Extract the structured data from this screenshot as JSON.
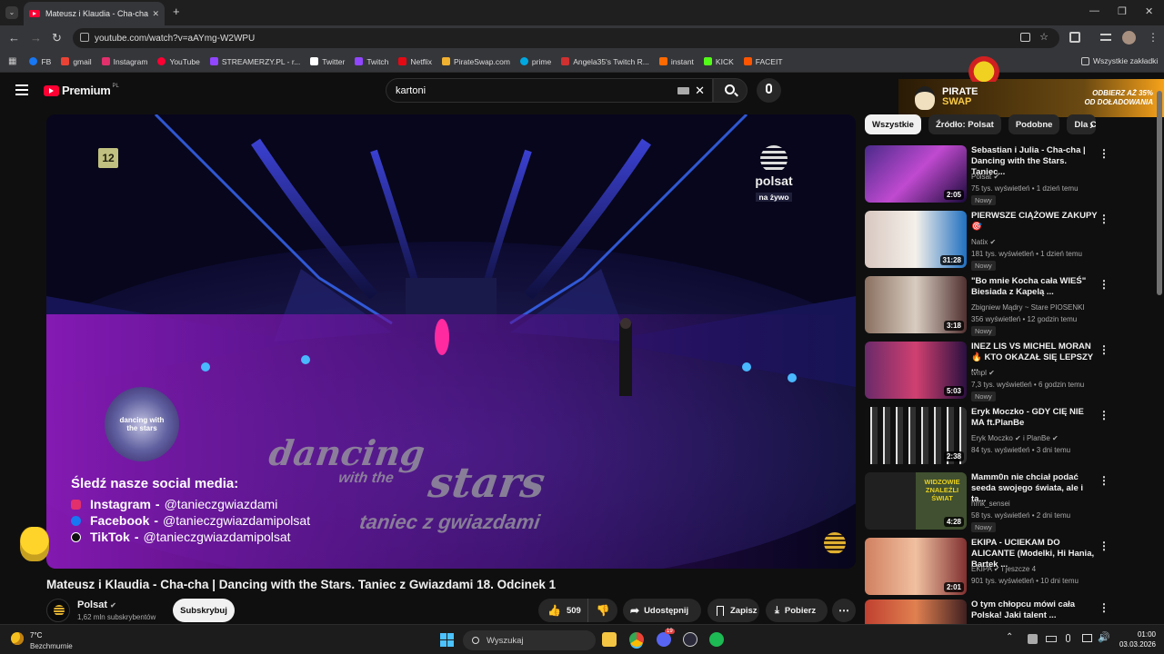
{
  "browser": {
    "tab_title": "Mateusz i Klaudia - Cha-cha | D",
    "tab_close": "✕",
    "new_tab": "+",
    "url": "youtube.com/watch?v=aAYmg-W2WPU",
    "window_minimize": "—",
    "window_maximize": "❐",
    "window_close": "✕",
    "bookmarks": [
      {
        "label": "FB",
        "color": "#1877f2"
      },
      {
        "label": "gmail",
        "color": "#ea4335"
      },
      {
        "label": "Instagram",
        "color": "#e1306c"
      },
      {
        "label": "YouTube",
        "color": "#ff0033"
      },
      {
        "label": "STREAMERZY.PL - r...",
        "color": "#9146ff"
      },
      {
        "label": "Twitter",
        "color": "#ffffff"
      },
      {
        "label": "Twitch",
        "color": "#9146ff"
      },
      {
        "label": "Netflix",
        "color": "#e50914"
      },
      {
        "label": "PirateSwap.com",
        "color": "#f0b030"
      },
      {
        "label": "prime",
        "color": "#00a8e1"
      },
      {
        "label": "Angela35's Twitch R...",
        "color": "#d03030"
      },
      {
        "label": "instant",
        "color": "#ff6a00"
      },
      {
        "label": "KICK",
        "color": "#53fc18"
      },
      {
        "label": "FACEIT",
        "color": "#ff5500"
      }
    ],
    "all_bookmarks": "Wszystkie zakładki"
  },
  "header": {
    "logo_text": "Premium",
    "logo_region": "PL",
    "search_value": "kartoni"
  },
  "ad": {
    "brand_line1": "PIRATE",
    "brand_line2": "SWAP",
    "promo_line1": "ODBIERZ AŻ 35%",
    "promo_line2": "OD DOŁADOWANIA"
  },
  "player": {
    "channel_badge": "12",
    "watermark": "polsat",
    "live_label": "na żywo",
    "show_logo": "dancing with the stars",
    "stage_line1": "dancing",
    "stage_line2": "with the",
    "stage_line3": "stars",
    "stage_line4": "taniec z gwiazdami",
    "social_heading": "Śledź nasze social media:",
    "social": [
      {
        "network": "Instagram",
        "handle": "@tanieczgwiazdami",
        "icon": "instagram-icon",
        "color": "#e1306c"
      },
      {
        "network": "Facebook",
        "handle": "@tanieczgwiazdamipolsat",
        "icon": "facebook-icon",
        "color": "#1877f2"
      },
      {
        "network": "TikTok",
        "handle": "@tanieczgwiazdamipolsat",
        "icon": "tiktok-icon",
        "color": "#000000"
      }
    ]
  },
  "video": {
    "title": "Mateusz i Klaudia - Cha-cha | Dancing with the Stars. Taniec z Gwiazdami 18. Odcinek 1",
    "channel": "Polsat",
    "subscribers": "1,62 mln subskrybentów",
    "subscribe_label": "Subskrybuj",
    "likes": "509",
    "share_label": "Udostępnij",
    "save_label": "Zapisz",
    "download_label": "Pobierz"
  },
  "chips": [
    "Wszystkie",
    "Źródło: Polsat",
    "Podobne",
    "Dla C"
  ],
  "recommendations": [
    {
      "title": "Sebastian i Julia - Cha-cha  | Dancing with the Stars. Taniec...",
      "channel": "Polsat",
      "verified": true,
      "meta": "75 tys. wyświetleń • 1 dzień temu",
      "badge": "Nowy",
      "duration": "2:05",
      "colors": [
        "#4a2a8a",
        "#c04ad0",
        "#1a0a3a"
      ]
    },
    {
      "title": "PIERWSZE CIĄŻOWE ZAKUPY",
      "title_line2": "🎯",
      "channel": "Natix",
      "verified": true,
      "meta": "181 tys. wyświetleń • 1 dzień temu",
      "badge": "Nowy",
      "duration": "31:28",
      "colors": [
        "#e8e2d8",
        "#f4f0ea",
        "#c02040"
      ]
    },
    {
      "title": "\"Bo mnie Kocha cała WIEŚ\" Biesiada z Kapelą ...",
      "channel": "Zbigniew Mądry ~ Stare PIOSENKI",
      "verified": false,
      "meta": "356 wyświetleń • 12 godzin temu",
      "badge": "Nowy",
      "duration": "3:18",
      "colors": [
        "#8a7060",
        "#d8ccc0",
        "#503030"
      ]
    },
    {
      "title": "INEZ LIS VS MICHEL MORAN 🔥 KTO OKAZAŁ SIĘ LEPSZY ...",
      "channel": "tvnpl",
      "verified": true,
      "meta": "7,3 tys. wyświetleń • 6 godzin temu",
      "badge": "Nowy",
      "duration": "5:03",
      "colors": [
        "#6a2a6a",
        "#d04070",
        "#2a1040"
      ]
    },
    {
      "title": "Eryk Moczko - GDY CIĘ NIE MA ft.PlanBe",
      "channel": "Eryk Moczko",
      "channel2": "i PlanBe",
      "verified": true,
      "meta": "84 tys. wyświetleń • 3 dni temu",
      "badge": "",
      "duration": "2:38",
      "colors": [
        "#101010",
        "#e0e0e0",
        "#303030"
      ]
    },
    {
      "title": "Mamm0n nie chciał podać seeda swojego świata, ale i ta...",
      "channel": "hmk_sensei",
      "verified": false,
      "meta": "58 tys. wyświetleń • 2 dni temu",
      "badge": "Nowy",
      "duration": "4:28",
      "overlay_text": "WIDZOWIE ZNALEŹLI ŚWIAT",
      "colors": [
        "#202020",
        "#e8d020",
        "#405030"
      ]
    },
    {
      "title": "EKIPA - UCIEKAM DO ALICANTE (Modelki, Hi Hania, Bartek ...",
      "channel": "EKIPA",
      "channel2": "i jeszcze 4",
      "verified": true,
      "meta": "901 tys. wyświetleń • 10 dni temu",
      "badge": "",
      "duration": "2:01",
      "colors": [
        "#d08060",
        "#f0c0a0",
        "#803030"
      ]
    },
    {
      "title": "O tym chłopcu mówi cała Polska! Jaki talent ...",
      "channel": "",
      "verified": false,
      "meta": "",
      "badge": "",
      "duration": "",
      "colors": [
        "#c04030",
        "#e08050",
        "#402020"
      ]
    }
  ],
  "taskbar": {
    "weather_temp": "7°C",
    "weather_desc": "Bezchmurnie",
    "search_placeholder": "Wyszukaj",
    "time": "01:00",
    "date": "03.03.2026",
    "discord_badge": "19"
  }
}
